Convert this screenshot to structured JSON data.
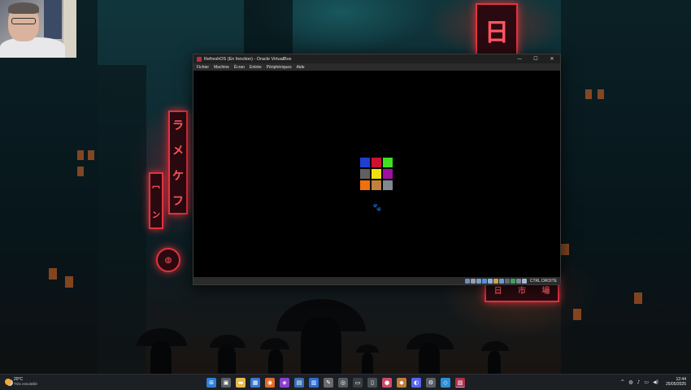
{
  "window": {
    "title": "RefreshOS (En fonction) - Oracle VirtualBox",
    "controls": {
      "minimize": "—",
      "maximize": "☐",
      "close": "✕"
    },
    "menu": [
      "Fichier",
      "Machine",
      "Écran",
      "Entrée",
      "Périphériques",
      "Aide"
    ],
    "logo_colors": [
      "#1f3fd0",
      "#d01030",
      "#40e020",
      "#606060",
      "#f0e010",
      "#a010a0",
      "#f07010",
      "#c08040",
      "#808890"
    ],
    "spinner_icon": "paw-icon",
    "host_key_label": "CTRL DROITE"
  },
  "taskbar": {
    "weather_temp": "20°C",
    "weather_desc": "Très ensoleillé",
    "apps": [
      {
        "name": "start-icon",
        "glyph": "⊞",
        "color": "#2f7fd6"
      },
      {
        "name": "task-view-icon",
        "glyph": "▣",
        "color": "#5a5f66"
      },
      {
        "name": "file-explorer-icon",
        "glyph": "▬",
        "color": "#e8b84a"
      },
      {
        "name": "store-icon",
        "glyph": "▦",
        "color": "#3a78d4"
      },
      {
        "name": "firefox-icon",
        "glyph": "◉",
        "color": "#e06a2a"
      },
      {
        "name": "browser-icon",
        "glyph": "◈",
        "color": "#8a3fd0"
      },
      {
        "name": "calculator-icon",
        "glyph": "▤",
        "color": "#3c6fb4"
      },
      {
        "name": "document-icon",
        "glyph": "▥",
        "color": "#2b6cd4"
      },
      {
        "name": "tool-icon",
        "glyph": "✎",
        "color": "#6a6a6a"
      },
      {
        "name": "dial-icon",
        "glyph": "◎",
        "color": "#555a60"
      },
      {
        "name": "terminal-icon",
        "glyph": "▭",
        "color": "#3a3f44"
      },
      {
        "name": "monitor-icon",
        "glyph": "▯",
        "color": "#4a4f55"
      },
      {
        "name": "apple-icon",
        "glyph": "●",
        "color": "#d04a6a"
      },
      {
        "name": "colorful-icon",
        "glyph": "◆",
        "color": "#c07a3a"
      },
      {
        "name": "discord-icon",
        "glyph": "◐",
        "color": "#5865f2"
      },
      {
        "name": "settings-icon",
        "glyph": "⚙",
        "color": "#5a5f66"
      },
      {
        "name": "vscode-icon",
        "glyph": "◇",
        "color": "#2d8fd5"
      },
      {
        "name": "virtualbox-icon",
        "glyph": "▧",
        "color": "#b0304a"
      }
    ],
    "tray": [
      "^",
      "◍",
      "♪",
      "▭",
      "◀)"
    ],
    "time": "12:44",
    "date": "25/05/2025"
  }
}
